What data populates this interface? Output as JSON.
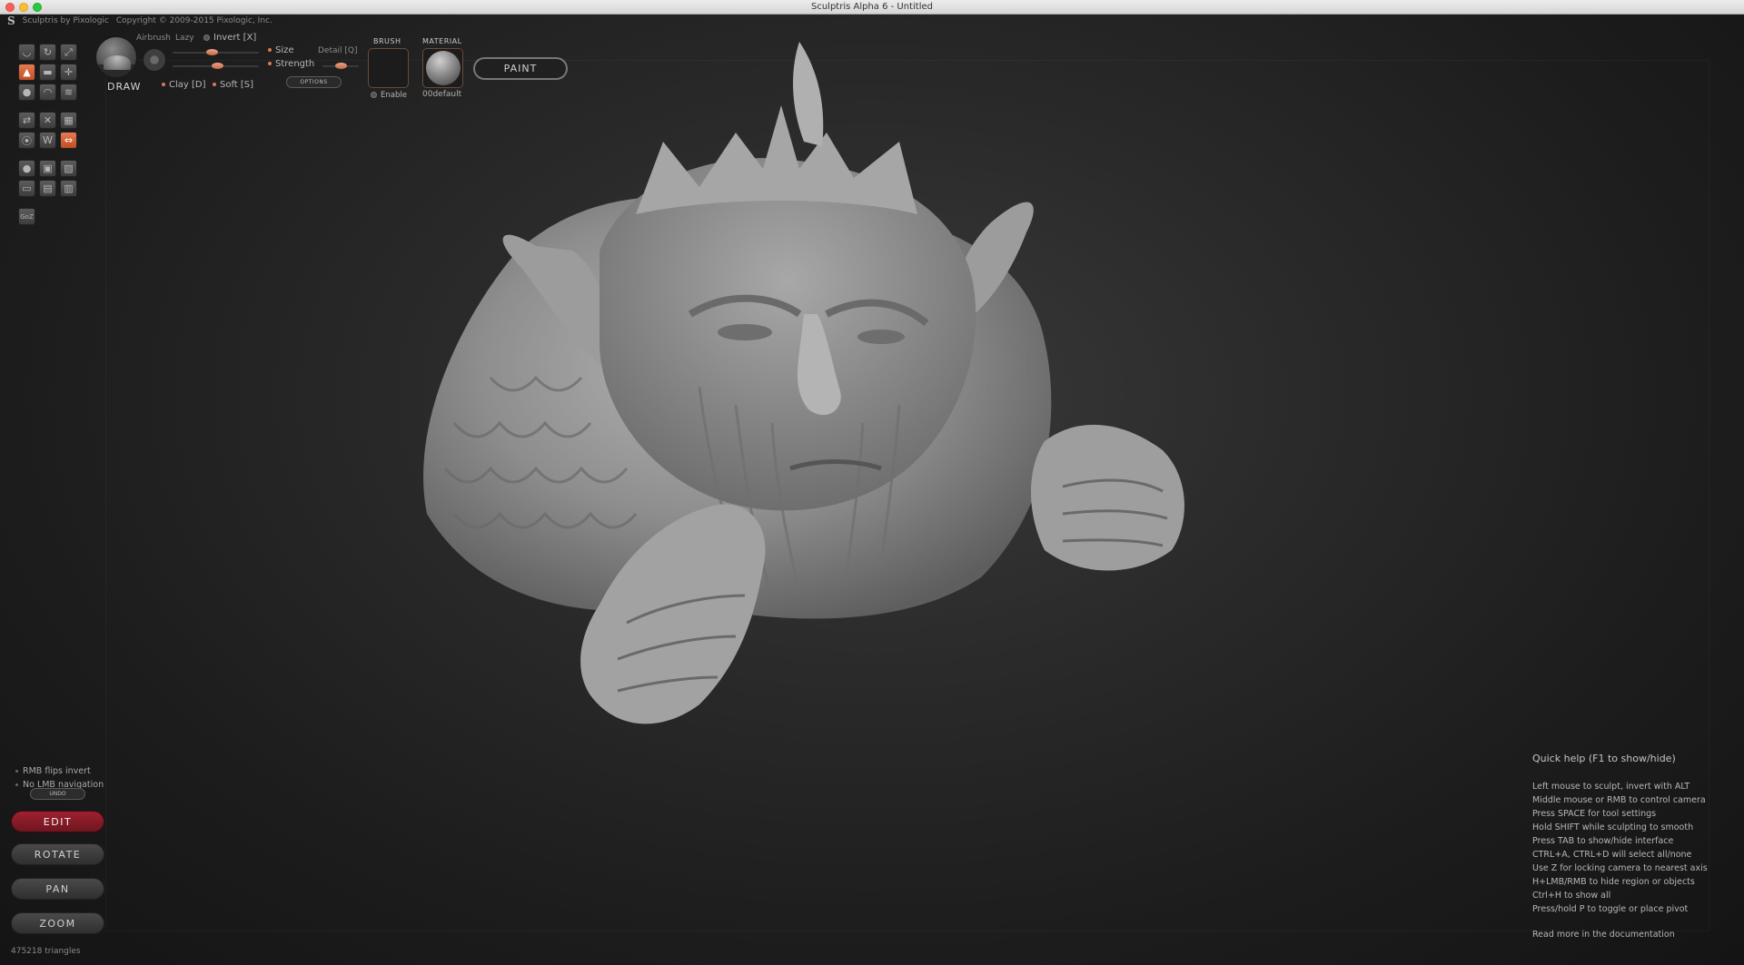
{
  "window": {
    "title": "Sculptris Alpha 6 - Untitled"
  },
  "app_info": {
    "name": "Sculptris by Pixologic",
    "copyright": "Copyright © 2009-2015 Pixologic, Inc."
  },
  "brush_panel": {
    "tool_name": "DRAW",
    "airbrush_label": "Airbrush",
    "lazy_label": "Lazy",
    "invert_label": "Invert [X]",
    "size_label": "Size",
    "detail_label": "Detail [Q]",
    "strength_label": "Strength",
    "clay_label": "Clay [D]",
    "soft_label": "Soft [S]",
    "options_label": "OPTIONS",
    "brush_heading": "BRUSH",
    "enable_label": "Enable",
    "material_heading": "MATERIAL",
    "material_name": "00default",
    "paint_label": "PAINT"
  },
  "left_options": {
    "rmb_flips": "RMB flips invert",
    "no_lmb": "No LMB navigation",
    "undo_label": "UNDO"
  },
  "nav": {
    "edit": "EDIT",
    "rotate": "ROTATE",
    "pan": "PAN",
    "zoom": "ZOOM"
  },
  "status": {
    "triangles": "475218 triangles"
  },
  "quick_help": {
    "title": "Quick help (F1 to show/hide)",
    "lines": [
      "Left mouse to sculpt, invert with ALT",
      "Middle mouse or RMB to control camera",
      "Press SPACE for tool settings",
      "Hold SHIFT while sculpting to smooth",
      "Press TAB to show/hide interface",
      "CTRL+A, CTRL+D will select all/none",
      "Use Z for locking camera to nearest axis",
      "H+LMB/RMB to hide region or objects",
      "Ctrl+H to show all",
      "Press/hold P to toggle or place pivot"
    ],
    "more": "Read more in the documentation"
  },
  "tools": {
    "items": [
      {
        "name": "crease-tool",
        "glyph": "◡",
        "active": false
      },
      {
        "name": "rotate-tool",
        "glyph": "↻",
        "active": false
      },
      {
        "name": "scale-tool",
        "glyph": "⤢",
        "active": false
      },
      {
        "name": "draw-tool",
        "glyph": "▲",
        "active": true
      },
      {
        "name": "flatten-tool",
        "glyph": "▬",
        "active": false
      },
      {
        "name": "grab-tool",
        "glyph": "✛",
        "active": false
      },
      {
        "name": "inflate-tool",
        "glyph": "●",
        "active": false
      },
      {
        "name": "pinch-tool",
        "glyph": "◠",
        "active": false
      },
      {
        "name": "smooth-tool",
        "glyph": "≋",
        "active": false
      },
      {
        "name": "symmetry-tool",
        "glyph": "⇄",
        "active": false
      },
      {
        "name": "mask-tool",
        "glyph": "✕",
        "active": false
      },
      {
        "name": "reduce-tool",
        "glyph": "▦",
        "active": false
      },
      {
        "name": "wireframe-tool",
        "glyph": "⦿",
        "active": false
      },
      {
        "name": "w-tool",
        "glyph": "W",
        "active": false
      },
      {
        "name": "mirror-tool",
        "glyph": "⇔",
        "active": true
      },
      {
        "name": "sphere-tool",
        "glyph": "●",
        "active": false
      },
      {
        "name": "camera-tool",
        "glyph": "▣",
        "active": false
      },
      {
        "name": "image-tool",
        "glyph": "▨",
        "active": false
      },
      {
        "name": "plane-tool",
        "glyph": "▭",
        "active": false
      },
      {
        "name": "save-tool",
        "glyph": "▤",
        "active": false
      },
      {
        "name": "export-tool",
        "glyph": "▥",
        "active": false
      },
      {
        "name": "goz-tool",
        "glyph": "GoZ",
        "active": false
      }
    ]
  },
  "colors": {
    "accent": "#d05a30",
    "edit_active": "#8a1b28",
    "background": "#2a2a2a"
  }
}
